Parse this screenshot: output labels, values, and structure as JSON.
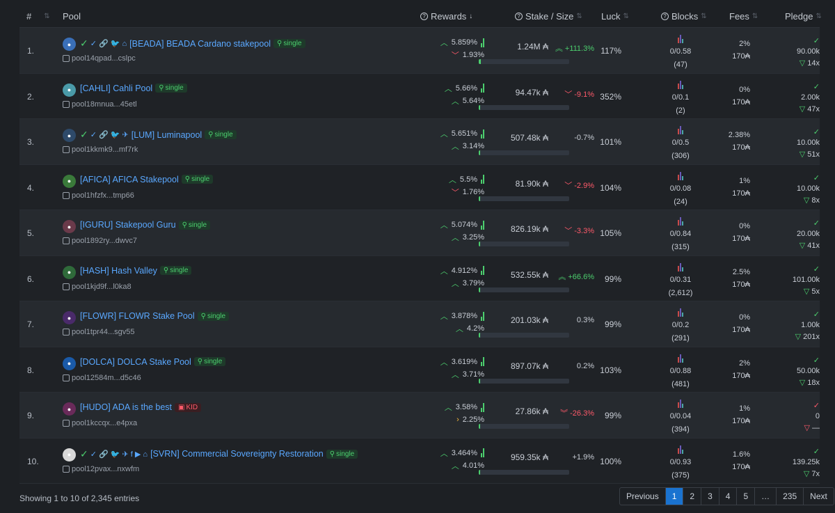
{
  "header": {
    "rank": "#",
    "pool": "Pool",
    "rewards": "Rewards",
    "stake_size": "Stake / Size",
    "luck": "Luck",
    "blocks": "Blocks",
    "fees": "Fees",
    "pledge": "Pledge"
  },
  "colors": {
    "accent": "#5aa8ff",
    "up": "#4ccf6e",
    "down": "#ff5a6a",
    "page_active": "#1a73d0"
  },
  "rows": [
    {
      "rank": "1.",
      "ticker": "[BEADA] BEADA Cardano stakepool",
      "tag": "single",
      "id": "pool14qpad...cslpc",
      "r1": "5.859%",
      "r1dir": "up",
      "r2": "1.93%",
      "r2dir": "down",
      "stake": "1.24M ₳",
      "chg": "+111.3%",
      "chgdir": "up2",
      "fill": 0.02,
      "luck": "117%",
      "blk": "0/0.58",
      "cnt": "(47)",
      "fee": "2%",
      "fix": "170₳",
      "pl": "90.00k",
      "mult": "14x",
      "badges": "✓ 🔗 🐦 ⌂",
      "logo": "#3a6fb8"
    },
    {
      "rank": "2.",
      "ticker": "[CAHLI] Cahli Pool",
      "tag": "single",
      "id": "pool18mnua...45etl",
      "r1": "5.66%",
      "r1dir": "up",
      "r2": "5.64%",
      "r2dir": "up",
      "stake": "94.47k ₳",
      "chg": "-9.1%",
      "chgdir": "down",
      "fill": 0.005,
      "luck": "352%",
      "blk": "0/0.1",
      "cnt": "(2)",
      "fee": "0%",
      "fix": "170₳",
      "pl": "2.00k",
      "mult": "47x",
      "badges": "",
      "logo": "#4a9aa8"
    },
    {
      "rank": "3.",
      "ticker": "[LUM] Luminapool",
      "tag": "single",
      "id": "pool1kkmk9...mf7rk",
      "r1": "5.651%",
      "r1dir": "up",
      "r2": "3.14%",
      "r2dir": "up",
      "stake": "507.48k ₳",
      "chg": "-0.7%",
      "chgdir": "none",
      "fill": 0.01,
      "luck": "101%",
      "blk": "0/0.5",
      "cnt": "(306)",
      "fee": "2.38%",
      "fix": "170₳",
      "pl": "10.00k",
      "mult": "51x",
      "badges": "✓ 🔗 🐦 ✈",
      "logo": "#2e4a6a"
    },
    {
      "rank": "4.",
      "ticker": "[AFICA] AFICA Stakepool",
      "tag": "single",
      "id": "pool1hfzfx...tmp66",
      "r1": "5.5%",
      "r1dir": "up",
      "r2": "1.76%",
      "r2dir": "down",
      "stake": "81.90k ₳",
      "chg": "-2.9%",
      "chgdir": "down",
      "fill": 0.005,
      "luck": "104%",
      "blk": "0/0.08",
      "cnt": "(24)",
      "fee": "1%",
      "fix": "170₳",
      "pl": "10.00k",
      "mult": "8x",
      "badges": "",
      "logo": "#3a7a3a"
    },
    {
      "rank": "5.",
      "ticker": "[IGURU] Stakepool Guru",
      "tag": "single",
      "id": "pool1892ry...dwvc7",
      "r1": "5.074%",
      "r1dir": "up",
      "r2": "3.25%",
      "r2dir": "up",
      "stake": "826.19k ₳",
      "chg": "-3.3%",
      "chgdir": "down",
      "fill": 0.01,
      "luck": "105%",
      "blk": "0/0.84",
      "cnt": "(315)",
      "fee": "0%",
      "fix": "170₳",
      "pl": "20.00k",
      "mult": "41x",
      "badges": "",
      "logo": "#6a3a4a"
    },
    {
      "rank": "6.",
      "ticker": "[HASH] Hash Valley",
      "tag": "single",
      "id": "pool1kjd9f...l0ka8",
      "r1": "4.912%",
      "r1dir": "up",
      "r2": "3.79%",
      "r2dir": "up",
      "stake": "532.55k ₳",
      "chg": "+66.6%",
      "chgdir": "up2",
      "fill": 0.01,
      "luck": "99%",
      "blk": "0/0.31",
      "cnt": "(2,612)",
      "fee": "2.5%",
      "fix": "170₳",
      "pl": "101.00k",
      "mult": "5x",
      "badges": "",
      "logo": "#2f6a3a"
    },
    {
      "rank": "7.",
      "ticker": "[FLOWR] FLOWR Stake Pool",
      "tag": "single",
      "id": "pool1tpr44...sgv55",
      "r1": "3.878%",
      "r1dir": "up",
      "r2": "4.2%",
      "r2dir": "up",
      "stake": "201.03k ₳",
      "chg": "0.3%",
      "chgdir": "none",
      "fill": 0.005,
      "luck": "99%",
      "blk": "0/0.2",
      "cnt": "(291)",
      "fee": "0%",
      "fix": "170₳",
      "pl": "1.00k",
      "mult": "201x",
      "badges": "",
      "logo": "#4a2a6a"
    },
    {
      "rank": "8.",
      "ticker": "[DOLCA] DOLCA Stake Pool",
      "tag": "single",
      "id": "pool12584m...d5c46",
      "r1": "3.619%",
      "r1dir": "up",
      "r2": "3.71%",
      "r2dir": "up",
      "stake": "897.07k ₳",
      "chg": "0.2%",
      "chgdir": "none",
      "fill": 0.01,
      "luck": "103%",
      "blk": "0/0.88",
      "cnt": "(481)",
      "fee": "2%",
      "fix": "170₳",
      "pl": "50.00k",
      "mult": "18x",
      "badges": "",
      "logo": "#1a5aa8"
    },
    {
      "rank": "9.",
      "ticker": "[HUDO] ADA is the best",
      "tag": "KID",
      "id": "pool1kccqx...e4pxa",
      "r1": "3.58%",
      "r1dir": "up",
      "r2": "2.25%",
      "r2dir": "amber",
      "stake": "27.86k ₳",
      "chg": "-26.3%",
      "chgdir": "down2",
      "fill": 0.003,
      "luck": "99%",
      "blk": "0/0.04",
      "cnt": "(394)",
      "fee": "1%",
      "fix": "170₳",
      "pl": "0",
      "mult": "—",
      "badges": "",
      "logo": "#6a2a5a"
    },
    {
      "rank": "10.",
      "ticker": "[SVRN] Commercial Sovereignty Restoration",
      "tag": "single",
      "id": "pool12pvax...nxwfm",
      "r1": "3.464%",
      "r1dir": "up",
      "r2": "4.01%",
      "r2dir": "up",
      "stake": "959.35k ₳",
      "chg": "+1.9%",
      "chgdir": "none",
      "fill": 0.01,
      "luck": "100%",
      "blk": "0/0.93",
      "cnt": "(375)",
      "fee": "1.6%",
      "fix": "170₳",
      "pl": "139.25k",
      "mult": "7x",
      "badges": "✓ 🔗 🐦 ✈ f ▶ ⌂",
      "logo": "#d8d8d8"
    }
  ],
  "footer": {
    "showing": "Showing 1 to 10 of 2,345 entries",
    "previous": "Previous",
    "pages": [
      "1",
      "2",
      "3",
      "4",
      "5",
      "…",
      "235"
    ],
    "next": "Next"
  }
}
